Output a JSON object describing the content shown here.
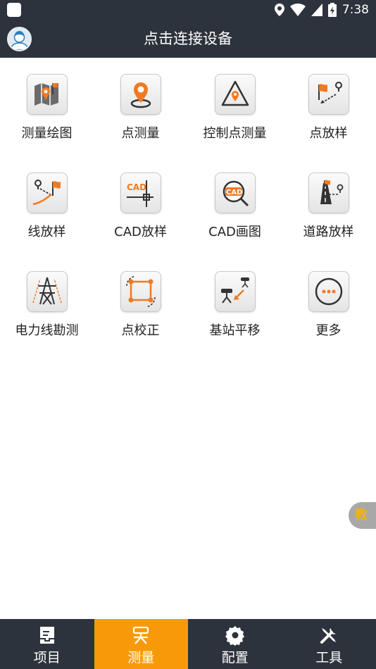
{
  "status_bar": {
    "time": "7:38"
  },
  "header": {
    "title": "点击连接设备"
  },
  "grid": {
    "items": [
      {
        "label": "测量绘图",
        "icon": "map-pin-icon"
      },
      {
        "label": "点测量",
        "icon": "location-pin-icon"
      },
      {
        "label": "控制点测量",
        "icon": "triangle-control-point-icon"
      },
      {
        "label": "点放样",
        "icon": "flag-point-stakeout-icon"
      },
      {
        "label": "线放样",
        "icon": "line-stakeout-icon"
      },
      {
        "label": "CAD放样",
        "icon": "cad-stakeout-icon"
      },
      {
        "label": "CAD画图",
        "icon": "cad-magnifier-icon"
      },
      {
        "label": "道路放样",
        "icon": "road-stakeout-icon"
      },
      {
        "label": "电力线勘测",
        "icon": "power-tower-icon"
      },
      {
        "label": "点校正",
        "icon": "point-calibration-icon"
      },
      {
        "label": "基站平移",
        "icon": "base-station-shift-icon"
      },
      {
        "label": "更多",
        "icon": "more-icon"
      }
    ]
  },
  "float_button": {
    "label": "教"
  },
  "bottom_nav": {
    "items": [
      {
        "label": "项目",
        "icon": "project-icon",
        "active": false
      },
      {
        "label": "测量",
        "icon": "survey-icon",
        "active": true
      },
      {
        "label": "配置",
        "icon": "gear-icon",
        "active": false
      },
      {
        "label": "工具",
        "icon": "tools-icon",
        "active": false
      }
    ]
  },
  "colors": {
    "bar": "#2d333c",
    "accent": "#f79a0a",
    "icon_orange": "#f07a22"
  }
}
